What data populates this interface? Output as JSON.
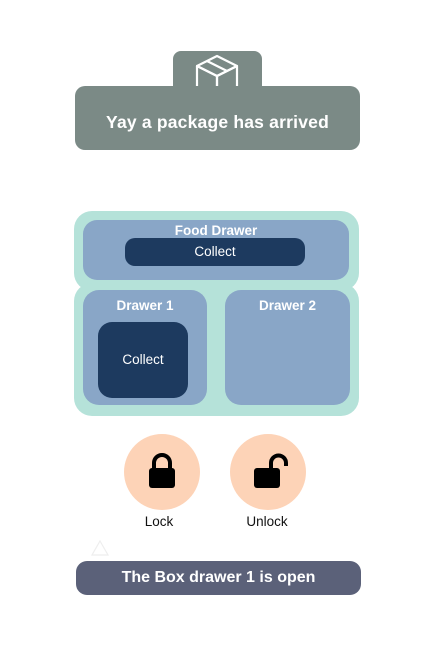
{
  "colors": {
    "banner": "#7b8a86",
    "cabinet": "#b5e2d9",
    "drawer": "#89a6c7",
    "collect_button": "#1d3a5f",
    "round_button": "#fdd3b7",
    "status_bar": "#5b6179"
  },
  "notification": {
    "icon": "package-icon",
    "message": "Yay a package has arrived"
  },
  "drawers": {
    "food": {
      "title": "Food Drawer",
      "button_label": "Collect"
    },
    "drawer1": {
      "title": "Drawer 1",
      "button_label": "Collect"
    },
    "drawer2": {
      "title": "Drawer 2"
    }
  },
  "controls": {
    "lock": {
      "icon": "lock-icon",
      "label": "Lock"
    },
    "unlock": {
      "icon": "unlock-icon",
      "label": "Unlock"
    }
  },
  "status": {
    "message": "The Box drawer 1 is open"
  }
}
